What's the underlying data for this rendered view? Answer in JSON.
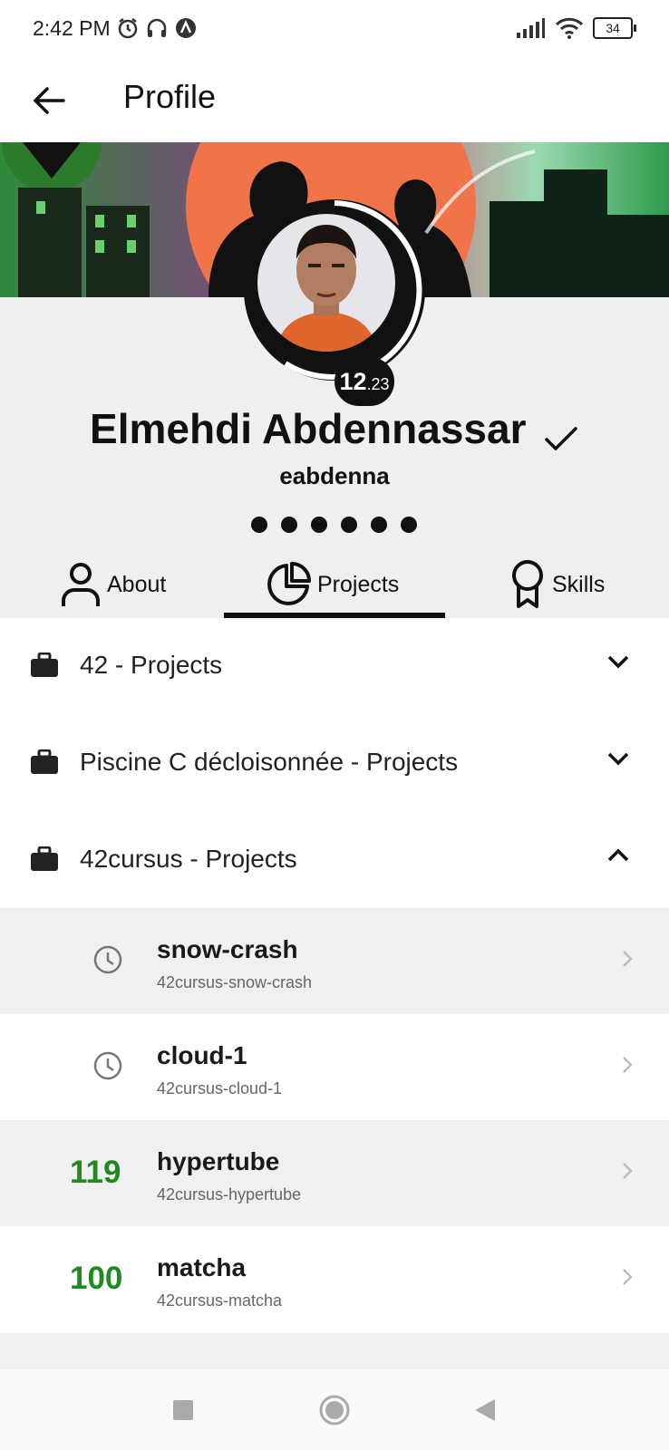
{
  "status": {
    "time": "2:42 PM",
    "battery": "34"
  },
  "appbar": {
    "title": "Profile"
  },
  "profile": {
    "name": "Elmehdi Abdennassar",
    "login": "eabdenna",
    "level_int": "12",
    "level_dec": ".23"
  },
  "tabs": [
    {
      "label": "About",
      "icon": "person-icon"
    },
    {
      "label": "Projects",
      "icon": "pie-chart-icon",
      "selected": true
    },
    {
      "label": "Skills",
      "icon": "award-icon"
    }
  ],
  "sections": [
    {
      "label": "42 - Projects",
      "expanded": false
    },
    {
      "label": "Piscine C décloisonnée - Projects",
      "expanded": false
    },
    {
      "label": "42cursus - Projects",
      "expanded": true
    }
  ],
  "projects": [
    {
      "name": "snow-crash",
      "slug": "42cursus-snow-crash",
      "status": "in-progress"
    },
    {
      "name": "cloud-1",
      "slug": "42cursus-cloud-1",
      "status": "in-progress"
    },
    {
      "name": "hypertube",
      "slug": "42cursus-hypertube",
      "score": "119"
    },
    {
      "name": "matcha",
      "slug": "42cursus-matcha",
      "score": "100"
    }
  ],
  "colors": {
    "score_green": "#1f8a1f",
    "profile_bg": "#efefef",
    "row_shaded": "#f0f0f0"
  }
}
